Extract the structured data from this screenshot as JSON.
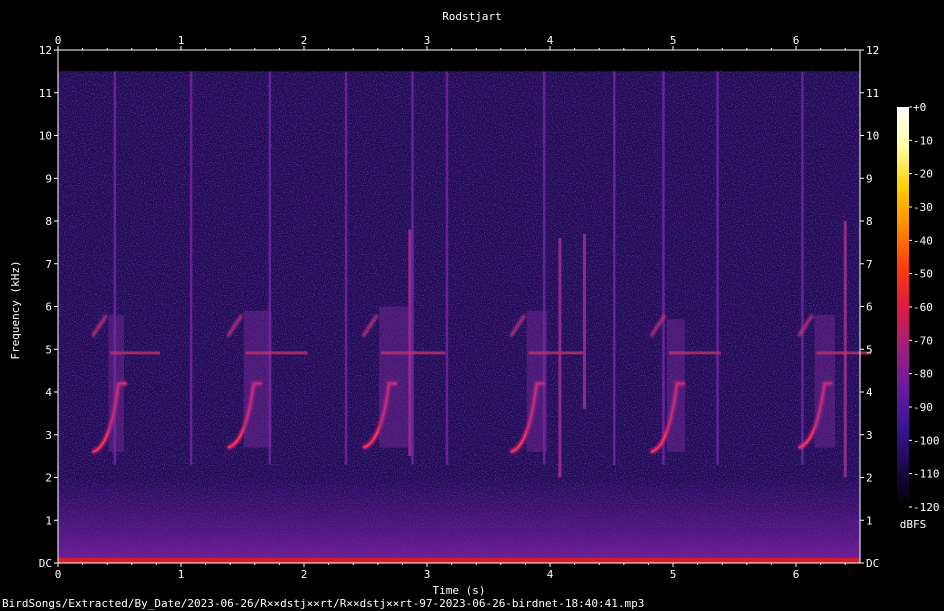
{
  "chart_data": {
    "type": "heatmap",
    "title": "Rodstjart",
    "xlabel": "Time (s)",
    "ylabel": "Frequency (kHz)",
    "xlim": [
      0,
      6.52
    ],
    "ylim": [
      0,
      12
    ],
    "x_ticks": [
      "0",
      "1",
      "2",
      "3",
      "4",
      "5",
      "6"
    ],
    "y_ticks": [
      "DC",
      "1",
      "2",
      "3",
      "4",
      "5",
      "6",
      "7",
      "8",
      "9",
      "10",
      "11",
      "12"
    ],
    "colorbar": {
      "unit": "dBFS",
      "range": [
        -120,
        0
      ],
      "ticks": [
        "+0",
        "-10",
        "-20",
        "-30",
        "-40",
        "-50",
        "-60",
        "-70",
        "-80",
        "-90",
        "-100",
        "-110",
        "-120"
      ],
      "colors": [
        "#000000",
        "#1a0a4a",
        "#3a1690",
        "#6a1aa0",
        "#a0207a",
        "#e01a40",
        "#ff3a10",
        "#ff8a00",
        "#ffd000",
        "#ffffa0",
        "#ffffff"
      ]
    },
    "spectrogram_upper_limit_khz": 11.5,
    "background_level_dbfs": -95,
    "calls": [
      {
        "start": 0.28,
        "end": 0.52,
        "f_low": 2.6,
        "f_high": 5.8
      },
      {
        "start": 1.38,
        "end": 1.72,
        "f_low": 2.7,
        "f_high": 5.9
      },
      {
        "start": 2.48,
        "end": 2.84,
        "f_low": 2.7,
        "f_high": 6.0
      },
      {
        "start": 3.68,
        "end": 3.96,
        "f_low": 2.6,
        "f_high": 5.9
      },
      {
        "start": 4.82,
        "end": 5.08,
        "f_low": 2.6,
        "f_high": 5.7
      },
      {
        "start": 6.02,
        "end": 6.3,
        "f_low": 2.7,
        "f_high": 5.8
      }
    ],
    "clicks": [
      0.46,
      1.08,
      1.72,
      2.34,
      2.88,
      3.16,
      3.95,
      4.52,
      4.92,
      5.36,
      6.05
    ],
    "vertical_lines": [
      {
        "t": 2.86,
        "f_low": 2.5,
        "f_high": 7.8
      },
      {
        "t": 4.08,
        "f_low": 2.0,
        "f_high": 7.6
      },
      {
        "t": 4.28,
        "f_low": 3.6,
        "f_high": 7.7
      },
      {
        "t": 6.4,
        "f_low": 2.0,
        "f_high": 8.0
      }
    ]
  },
  "footer": {
    "file_path": "BirdSongs/Extracted/By_Date/2023-06-26/R××dstj××rt/R××dstj××rt-97-2023-06-26-birdnet-18:40:41.mp3"
  }
}
